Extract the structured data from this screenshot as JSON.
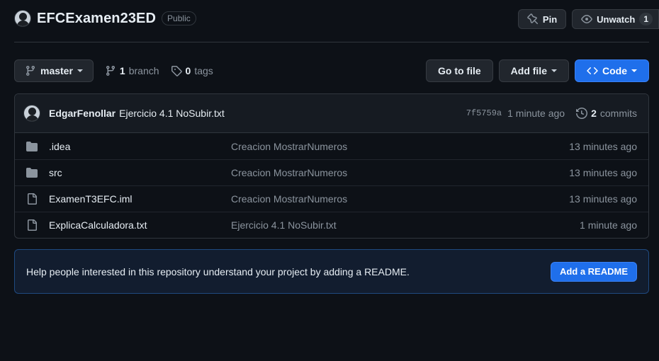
{
  "repo": {
    "name": "EFCExamen23ED",
    "visibility": "Public",
    "pin_label": "Pin",
    "unwatch_label": "Unwatch",
    "watch_count": "1"
  },
  "toolbar": {
    "branch_name": "master",
    "branch_count": "1",
    "branch_word": "branch",
    "tag_count": "0",
    "tag_word": "tags",
    "goto_file": "Go to file",
    "add_file": "Add file",
    "code": "Code"
  },
  "commit": {
    "author": "EdgarFenollar",
    "message": "Ejercicio 4.1 NoSubir.txt",
    "sha": "7f5759a",
    "age": "1 minute ago",
    "commit_count": "2",
    "commit_word": "commits"
  },
  "files": [
    {
      "name": ".idea",
      "type": "folder",
      "message": "Creacion MostrarNumeros",
      "age": "13 minutes ago"
    },
    {
      "name": "src",
      "type": "folder",
      "message": "Creacion MostrarNumeros",
      "age": "13 minutes ago"
    },
    {
      "name": "ExamenT3EFC.iml",
      "type": "file",
      "message": "Creacion MostrarNumeros",
      "age": "13 minutes ago"
    },
    {
      "name": "ExplicaCalculadora.txt",
      "type": "file",
      "message": "Ejercicio 4.1 NoSubir.txt",
      "age": "1 minute ago"
    }
  ],
  "readme": {
    "text": "Help people interested in this repository understand your project by adding a README.",
    "button": "Add a README"
  },
  "colors": {
    "background": "#0d1117",
    "accent": "#1f6feb",
    "muted": "#8b949e"
  }
}
